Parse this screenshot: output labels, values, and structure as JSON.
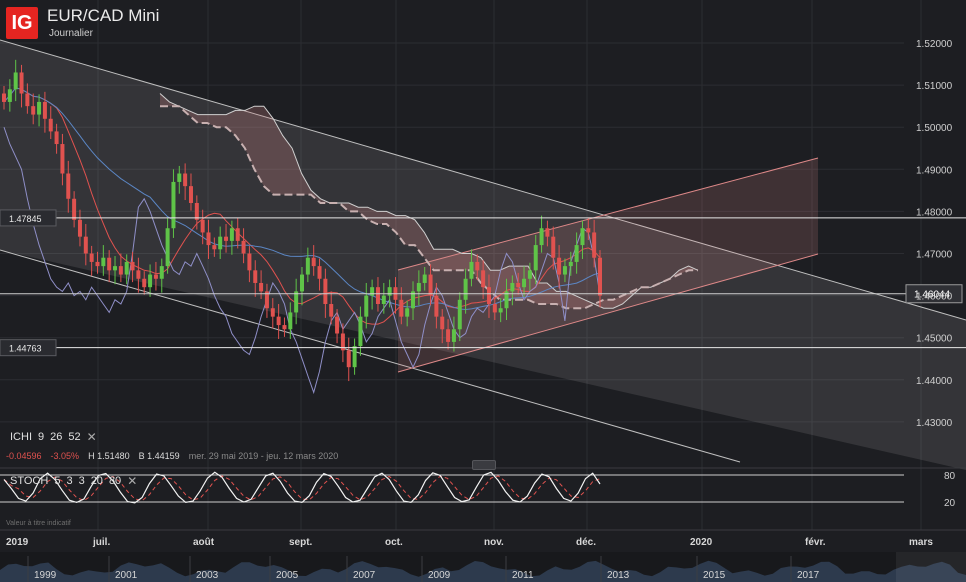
{
  "header": {
    "logo_text": "IG",
    "title": "EUR/CAD Mini",
    "subtitle": "Journalier"
  },
  "indicators": {
    "ichi": {
      "name": "ICHI",
      "params": [
        "9",
        "26",
        "52"
      ],
      "close_glyph": "✕"
    },
    "stoch": {
      "name": "STOCH",
      "params": [
        "5",
        "3",
        "3",
        "20",
        "80"
      ],
      "close_glyph": "✕"
    },
    "stoch_note": "Valeur à titre indicatif"
  },
  "info_bar": {
    "change": "-0.04596",
    "change_pct": "-3.05%",
    "high_label": "H",
    "high": "1.51480",
    "low_label": "B",
    "low": "1.44159",
    "range": "mer. 29 mai 2019 - jeu. 12 mars 2020"
  },
  "markers": {
    "upper_level": "1.47845",
    "lower_level": "1.44763",
    "current_price": "1.46044"
  },
  "colors": {
    "background": "#1d1e22",
    "up_candle": "#5fc448",
    "down_candle": "#e0524f",
    "channel_fill": "#ffffff",
    "cloud_fill": "#c98080",
    "brand": "#e52521"
  },
  "chart_data": {
    "type": "candlestick",
    "instrument": "EUR/CAD Mini",
    "timeframe": "Journalier",
    "y_axis": {
      "ticks": [
        "1.52000",
        "1.51000",
        "1.50000",
        "1.49000",
        "1.48000",
        "1.47000",
        "1.46000",
        "1.45000",
        "1.44000",
        "1.43000"
      ],
      "range": [
        1.4225,
        1.5305
      ]
    },
    "x_axis": {
      "labels": [
        "2019",
        "juil.",
        "août",
        "sept.",
        "oct.",
        "nov.",
        "déc.",
        "2020",
        "févr.",
        "mars"
      ]
    },
    "horizontal_levels": [
      1.47845,
      1.44763,
      1.46044
    ],
    "close_series": [
      1.506,
      1.509,
      1.513,
      1.508,
      1.505,
      1.503,
      1.506,
      1.502,
      1.499,
      1.496,
      1.489,
      1.483,
      1.478,
      1.474,
      1.47,
      1.468,
      1.467,
      1.469,
      1.466,
      1.467,
      1.465,
      1.468,
      1.466,
      1.464,
      1.462,
      1.465,
      1.464,
      1.467,
      1.476,
      1.487,
      1.489,
      1.486,
      1.482,
      1.478,
      1.475,
      1.472,
      1.471,
      1.474,
      1.473,
      1.476,
      1.473,
      1.47,
      1.466,
      1.463,
      1.461,
      1.457,
      1.455,
      1.453,
      1.452,
      1.456,
      1.461,
      1.465,
      1.469,
      1.467,
      1.464,
      1.458,
      1.455,
      1.451,
      1.447,
      1.443,
      1.448,
      1.455,
      1.46,
      1.462,
      1.458,
      1.46,
      1.462,
      1.459,
      1.455,
      1.457,
      1.461,
      1.463,
      1.465,
      1.46,
      1.455,
      1.452,
      1.449,
      1.452,
      1.459,
      1.464,
      1.468,
      1.466,
      1.462,
      1.458,
      1.456,
      1.457,
      1.461,
      1.463,
      1.462,
      1.464,
      1.466,
      1.472,
      1.476,
      1.474,
      1.469,
      1.465,
      1.467,
      1.468,
      1.472,
      1.476,
      1.475,
      1.469,
      1.46
    ],
    "ichimoku": {
      "senkou_a": [
        1.508,
        1.506,
        1.505,
        1.504,
        1.503,
        1.503,
        1.503,
        1.503,
        1.504,
        1.504,
        1.505,
        1.505,
        1.502,
        1.498,
        1.495,
        1.489,
        1.485,
        1.483,
        1.482,
        1.482,
        1.482,
        1.481,
        1.481,
        1.48,
        1.48,
        1.479,
        1.479,
        1.478,
        1.475,
        1.471,
        1.471,
        1.471,
        1.47,
        1.47,
        1.469,
        1.466,
        1.466,
        1.467,
        1.467,
        1.467,
        1.463,
        1.463,
        1.461,
        1.461,
        1.46,
        1.459,
        1.458,
        1.457,
        1.457,
        1.458,
        1.46,
        1.462,
        1.462,
        1.463,
        1.464,
        1.466,
        1.467,
        1.466
      ],
      "senkou_b": [
        1.505,
        1.505,
        1.505,
        1.503,
        1.501,
        1.501,
        1.5,
        1.5,
        1.498,
        1.495,
        1.49,
        1.486,
        1.484,
        1.484,
        1.484,
        1.484,
        1.484,
        1.482,
        1.482,
        1.482,
        1.48,
        1.48,
        1.478,
        1.477,
        1.477,
        1.475,
        1.472,
        1.472,
        1.469,
        1.466,
        1.466,
        1.466,
        1.466,
        1.466,
        1.463,
        1.461,
        1.459,
        1.459,
        1.459,
        1.459,
        1.458,
        1.458,
        1.458,
        1.457,
        1.457,
        1.457,
        1.458,
        1.459,
        1.459,
        1.46,
        1.461,
        1.462,
        1.462,
        1.463,
        1.464,
        1.465,
        1.466,
        1.466
      ]
    },
    "stochastic": {
      "levels": [
        80,
        20
      ],
      "k_values": [
        70,
        50,
        28,
        22,
        40,
        72,
        84,
        70,
        46,
        24,
        19,
        27,
        55,
        79,
        83,
        67,
        42,
        21,
        18,
        30,
        61,
        82,
        78,
        56,
        33,
        19,
        22,
        45,
        73,
        86,
        75,
        50,
        28,
        20,
        26,
        52,
        78,
        84,
        66,
        40,
        22,
        19,
        34,
        64,
        83,
        77,
        55,
        30,
        20,
        24,
        50,
        76,
        84,
        70,
        44,
        22,
        19,
        36,
        68,
        85,
        79,
        54,
        30,
        21,
        25,
        53,
        80,
        86,
        68,
        43,
        24,
        20,
        33,
        62,
        82,
        76,
        50,
        28,
        22,
        40,
        72,
        84,
        60
      ]
    }
  },
  "navigator": {
    "years": [
      "1999",
      "2001",
      "2003",
      "2005",
      "2007",
      "2009",
      "2011",
      "2013",
      "2015",
      "2017"
    ]
  }
}
